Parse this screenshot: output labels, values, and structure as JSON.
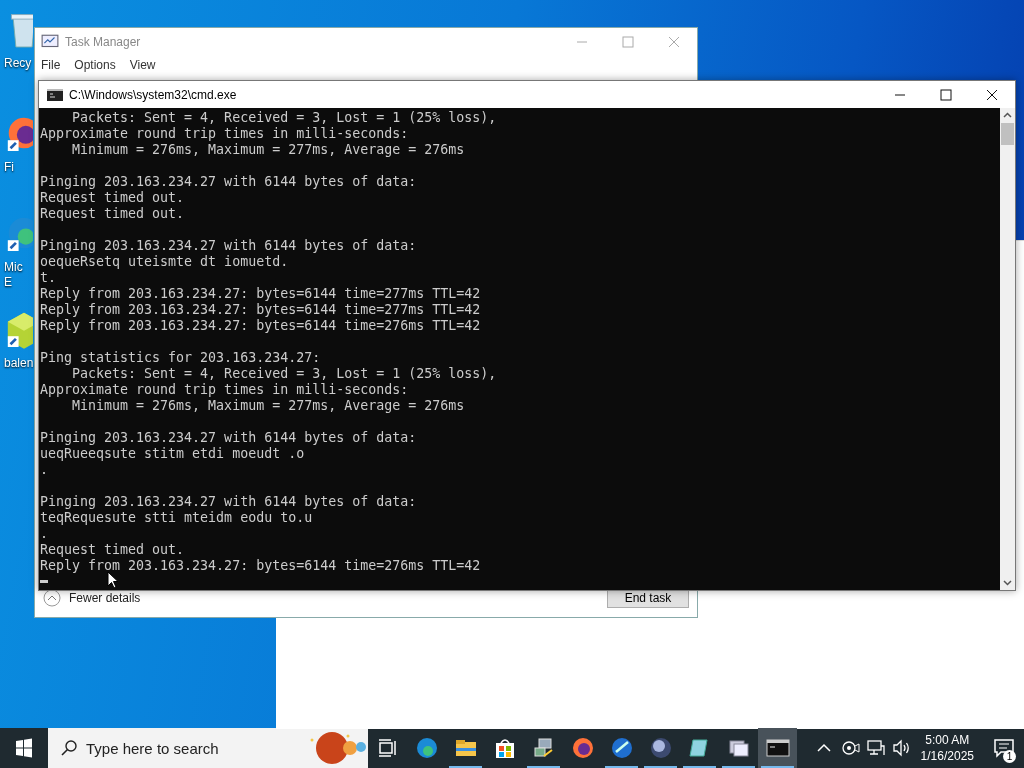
{
  "desktop_icons": [
    {
      "kind": "recycle",
      "label": "Recy"
    },
    {
      "kind": "firefox",
      "label": "Fi"
    },
    {
      "kind": "edge",
      "label": "Mic\nE"
    },
    {
      "kind": "balena",
      "label": "balen"
    }
  ],
  "task_manager": {
    "title": "Task Manager",
    "menu": [
      "File",
      "Options",
      "View"
    ],
    "fewer_details": "Fewer details",
    "end_task": "End task"
  },
  "cmd": {
    "title": "C:\\Windows\\system32\\cmd.exe",
    "blocks": [
      [
        "    Packets: Sent = 4, Received = 3, Lost = 1 (25% loss),",
        "Approximate round trip times in milli-seconds:",
        "    Minimum = 276ms, Maximum = 277ms, Average = 276ms"
      ],
      [
        "Pinging 203.163.234.27 with 6144 bytes of data:",
        "Request timed out.",
        "Request timed out."
      ],
      [
        "Pinging 203.163.234.27 with 6144 bytes of data:",
        "oequeRsetq uteismte dt iomuetd.",
        "t.",
        "Reply from 203.163.234.27: bytes=6144 time=277ms TTL=42",
        "Reply from 203.163.234.27: bytes=6144 time=277ms TTL=42",
        "Reply from 203.163.234.27: bytes=6144 time=276ms TTL=42"
      ],
      [
        "Ping statistics for 203.163.234.27:",
        "    Packets: Sent = 4, Received = 3, Lost = 1 (25% loss),",
        "Approximate round trip times in milli-seconds:",
        "    Minimum = 276ms, Maximum = 277ms, Average = 276ms"
      ],
      [
        "Pinging 203.163.234.27 with 6144 bytes of data:",
        "ueqRueeqsute stitm etdi moeudt .o",
        "."
      ],
      [
        "Pinging 203.163.234.27 with 6144 bytes of data:",
        "teqRequesute stti mteidm eodu to.u",
        ".",
        "Request timed out.",
        "Reply from 203.163.234.27: bytes=6144 time=276ms TTL=42"
      ]
    ]
  },
  "taskbar": {
    "search_placeholder": "Type here to search",
    "items": [
      {
        "kind": "taskview",
        "running": false,
        "selected": false
      },
      {
        "kind": "edge",
        "running": false,
        "selected": false
      },
      {
        "kind": "explorer",
        "running": true,
        "selected": false
      },
      {
        "kind": "store",
        "running": false,
        "selected": false
      },
      {
        "kind": "network",
        "running": true,
        "selected": false
      },
      {
        "kind": "firefox",
        "running": false,
        "selected": false
      },
      {
        "kind": "bluedisc",
        "running": true,
        "selected": false
      },
      {
        "kind": "globe",
        "running": true,
        "selected": false
      },
      {
        "kind": "notepad",
        "running": true,
        "selected": false
      },
      {
        "kind": "windows",
        "running": true,
        "selected": false
      },
      {
        "kind": "cmd",
        "running": true,
        "selected": true
      }
    ],
    "time": "5:00 AM",
    "date": "1/16/2025",
    "notifications": "1"
  }
}
